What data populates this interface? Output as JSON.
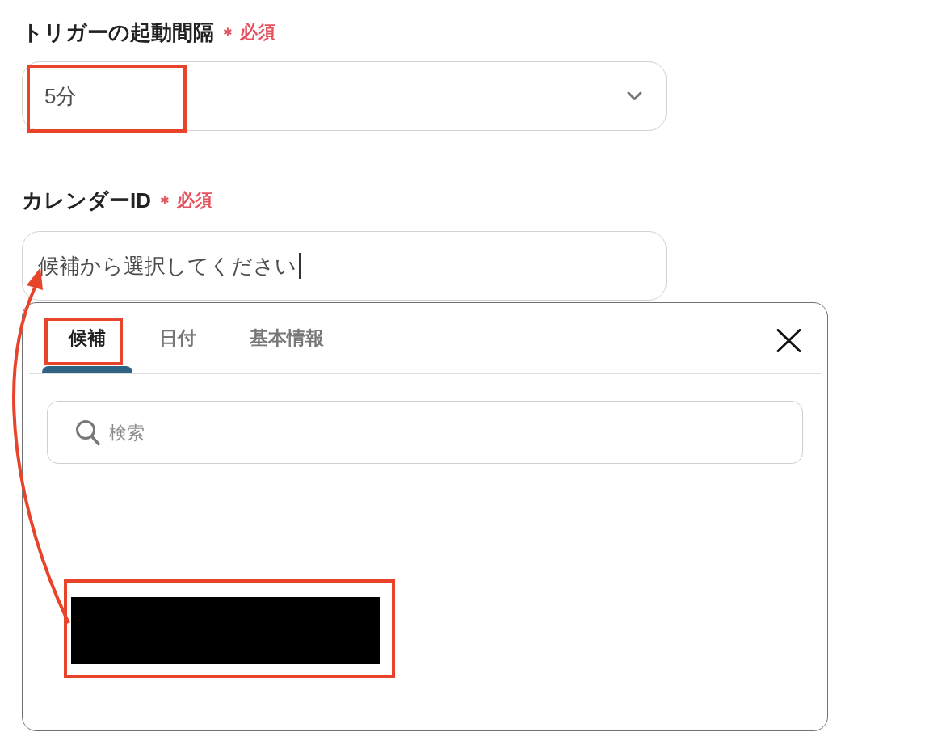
{
  "trigger_interval": {
    "label": "トリガーの起動間隔",
    "required_mark": "＊",
    "required_text": "必須",
    "value": "5分",
    "highlighted": true
  },
  "calendar_id": {
    "label": "カレンダーID",
    "required_mark": "＊",
    "required_text": "必須",
    "value": "候補から選択してください",
    "focused": true
  },
  "picker": {
    "tabs": [
      {
        "label": "候補",
        "selected": true,
        "highlighted": true
      },
      {
        "label": "日付",
        "selected": false,
        "highlighted": false
      },
      {
        "label": "基本情報",
        "selected": false,
        "highlighted": false
      }
    ],
    "search": {
      "placeholder": "検索"
    },
    "candidates": [
      {
        "kind": "redacted",
        "highlighted": true,
        "arrow_to_field": true
      }
    ]
  }
}
